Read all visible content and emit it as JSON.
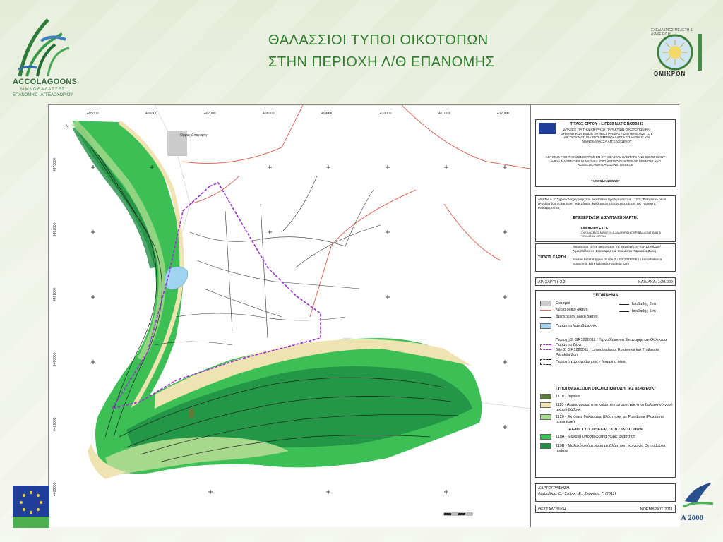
{
  "slide": {
    "title_line1": "ΘΑΛΑΣΣΙΟΙ ΤΥΠΟΙ ΟΙΚΟΤΟΠΩΝ",
    "title_line2": "ΣΤΗΝ ΠΕΡΙΟΧΗ Λ/Θ ΕΠΑΝΟΜΗΣ",
    "left_logo": {
      "name": "ACCOLAGOONS",
      "sub1": "ΛΙΜΝΟΘΑΛΑΣΣΕΣ",
      "sub2": "ΕΠΑΝΟΜΗΣ - ΑΓΓΕΛΟΧΩΡΙΟΥ"
    },
    "right_logo": {
      "top": "ΣΧΕΔΙΑΣΜΟΣ ΜΕΛΕΤΗ & ΔΙΑΧΕΙΡΙΣΗ",
      "name": "ΟΜΙΚΡΟΝ"
    },
    "bottom_right_logo": "A 2000",
    "colors": {
      "title": "#2f7d2f",
      "accent": "#1f3f9a"
    }
  },
  "map": {
    "top_coords": [
      "405000",
      "406000",
      "407000",
      "408000",
      "409000",
      "410000",
      "411000",
      "412000"
    ],
    "left_coords": [
      "4473000",
      "4472000",
      "4471000",
      "4470000",
      "4469000",
      "4468000"
    ],
    "place_label": "Όρμος Επανομής"
  },
  "legend": {
    "project_title_gr": "ΤΙΤΛΟΣ ΕΡΓΟΥ : LIFE09 NAT/GR/000343",
    "project_desc_gr": "ΔΡΑΣΕΙΣ ΓΙΑ ΤΗ ΔΙΑΤΗΡΗΣΗ ΠΑΡΑΚΤΙΩΝ ΟΙΚΟΤΟΠΩΝ ΚΑΙ ΣΗΜΑΝΤΙΚΩΝ ΕΙΔΩΝ ΟΡΝΙΘΟΠΑΝΙΔΑΣ ΤΩΝ ΠΕΡΙΟΧΩΝ ΤΟΥ ΔΙΚΤΥΟΥ NATURA 2000 ΛΙΜΝΟΘΑΛΑΣΣΑ ΕΠΑΝΟΜΗΣ ΚΑΙ ΛΙΜΝΟΘΑΛΑΣΣΑ ΑΓΓΕΛΟΧΩΡΙΟΥ",
    "project_desc_en": "ACTIONS FOR THE CONSERVATION OF COASTAL HABITATS AND SIGNIFICANT AVIFAUNA SPECIES IN NATURA 2000 NETWORK SITES OF EPANOMI AND AGGELOCHORI LAGOONS, GREECE",
    "project_short": "\"ACCOLAGOONS\"",
    "action_gr": "ΔΡΑΣΗ Α.2: Σχέδιο διαχείρισης του οικοτόπου προτεραιότητας 1120* \"Posidonia beds (Posidonion oceanicae)\" και άλλων θαλάσσιων τύπων οικοτόπων της περιοχής ενδιαφέροντος",
    "action_en": "ACTION A.2: Management plan of the priority habitat type 1120* \"Posidonia beds (Posidonion oceanicae)\" and of other marine habitat types of the project marine zone",
    "processing_title": "ΕΠΕΞΕΡΓΑΣΙΑ & ΣΥΝΤΑΞΗ ΧΑΡΤΗ:",
    "processing_company": "ΟΜΙΚΡΟΝ Ε.Π.Ε.",
    "processing_desc": "ΣΧΕΔΙΑΣΜΟΣ ΜΕΛΕΤΗ & ΔΙΑΧΕΙΡΙΣΗ ΠΕΡΙΒΑΛΛΟΝΤΙΚΩΝ & ΤΕΧΝΙΚΩΝ ΕΡΓΩΝ",
    "map_title_label": "ΤΙΤΛΟΣ ΧΑΡΤΗ",
    "map_title_gr": "Θαλάσσιοι τύποι οικοτόπων της περιοχής 2 - GR1220012 / Λιμνοθάλασσα Επανομής και Θάλασσα Παράκτια Ζώνη",
    "map_title_en": "Marine habitat types of site 2 - GR1220005 / Limnothalassa Epanomis kai Thalassia Paraktia Zoni",
    "map_no": "ΑΡ. ΧΑΡΤΗ: 2.2",
    "scale": "ΚΛΙΜΑΚΑ: 1:20.000",
    "legend_title": "ΥΠΟΜΝΗΜΑ",
    "items": {
      "settlements": "Οικισμοί",
      "main_road": "Κύριο οδικό δίκτυο",
      "secondary_road": "Δευτερεύον οδικό δίκτυο",
      "lagoon": "Παράκτια λιμνοθάλασσα",
      "isobath2": "Ισοβαθής 2 m",
      "isobath5": "Ισοβαθής 5 m",
      "area2_gr": "Περιοχή 2: GR1220011 / Λιμνοθάλασσα Επανομής και Θάλασσα Παράκτια Ζώνη",
      "area2_en": "Site 2: GR1220011 / Limnothalassa Epanomis kai Thalassia Paraktia Zoni",
      "mapping_area": "Περιοχή χαρτογράφησης - Mapping area"
    },
    "habitat_title": "ΤΥΠΟΙ ΘΑΛΑΣΣΙΩΝ ΟΙΚΟΤΟΠΩΝ ΟΔΗΓΙΑΣ 92/43/ΕΟΚ*",
    "habitats": [
      {
        "code": "1170 - Ύφαλοι",
        "color": "#5c7a3a"
      },
      {
        "code": "1110 - Αμμοσύρσεις που καλύπτονται συνεχώς από θαλασσινό νερό μικρού βάθους",
        "color": "#efe3b2"
      },
      {
        "code": "1120 - Εκτάσεις θαλάσσιας βλάστησης με Posidonia (Posidonia oceanicae)",
        "color": "#a6d98c"
      }
    ],
    "other_title": "ΑΛΛΟΙ ΤΥΠΟΙ ΘΑΛΑΣΣΙΩΝ ΟΙΚΟΤΟΠΩΝ",
    "others": [
      {
        "code": "119A - Μαλακό υποστρώματα χωρίς βλάστηση",
        "color": "#3cbf55"
      },
      {
        "code": "119B - Μαλακό υπόστρωμα με βλάστηση, κοινωνία Cymodocea nodosa",
        "color": "#1f8f45"
      }
    ],
    "cartography_title": "ΧΑΡΤΟΓΡΑΦΗΣΗ:",
    "cartography_names": "Λαζαρίδου, Θ., Σπίνος, Ε., Σκουφάς, Γ (2011)",
    "city": "ΘΕΣΣΑΛΟΝΙΚΗ",
    "date": "ΝΟΕΜΒΡΙΟΣ 2011"
  }
}
